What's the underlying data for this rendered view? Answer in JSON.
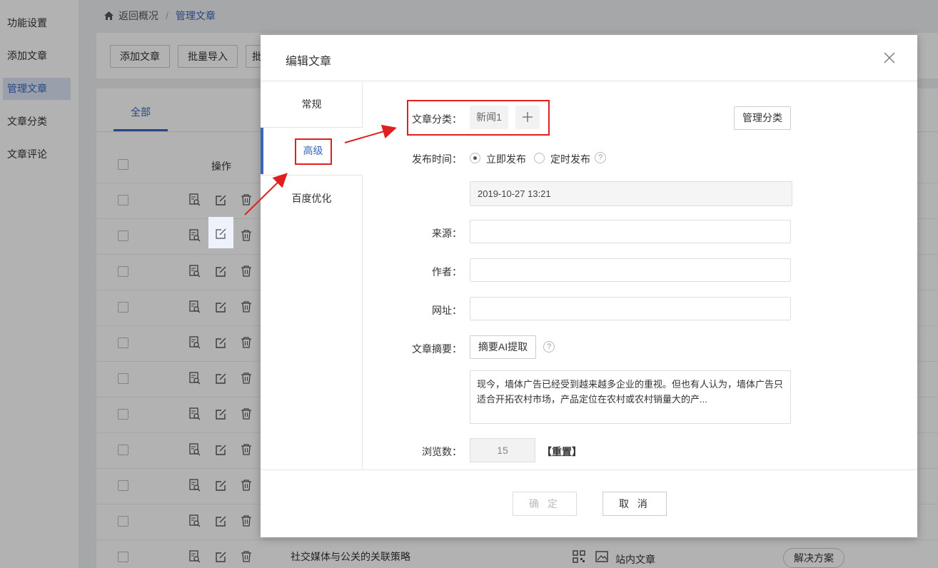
{
  "sidebar": {
    "items": [
      {
        "label": "功能设置"
      },
      {
        "label": "添加文章"
      },
      {
        "label": "管理文章"
      },
      {
        "label": "文章分类"
      },
      {
        "label": "文章评论"
      }
    ]
  },
  "breadcrumb": {
    "back": "返回概况",
    "separator": "/",
    "current": "管理文章"
  },
  "toolbar": {
    "add": "添加文章",
    "import": "批量导入",
    "more": "批"
  },
  "list": {
    "tab_all": "全部",
    "col_operation": "操作",
    "last_row": {
      "title": "社交媒体与公关的关联策略",
      "type": "站内文章",
      "tag": "解决方案"
    }
  },
  "dialog": {
    "title": "编辑文章",
    "tabs": [
      {
        "label": "常规"
      },
      {
        "label": "高级"
      },
      {
        "label": "百度优化"
      }
    ],
    "category": {
      "label": "文章分类：",
      "chip": "新闻1",
      "manage": "管理分类"
    },
    "publish": {
      "label": "发布时间：",
      "now": "立即发布",
      "scheduled": "定时发布",
      "help": "?",
      "datetime": "2019-10-27 13:21"
    },
    "source": {
      "label": "来源："
    },
    "author": {
      "label": "作者："
    },
    "url": {
      "label": "网址："
    },
    "summary": {
      "label": "文章摘要：",
      "ai_button": "摘要AI提取",
      "help": "?",
      "text": "现今，墙体广告已经受到越来越多企业的重视。但也有人认为，墙体广告只适合开拓农村市场，产品定位在农村或农村销量大的产..."
    },
    "views": {
      "label": "浏览数：",
      "value": "15",
      "reset": "【重置】"
    },
    "footer": {
      "ok": "确 定",
      "cancel": "取 消"
    }
  },
  "colors": {
    "accent": "#3a66b8",
    "annotation_red": "#e02020"
  }
}
